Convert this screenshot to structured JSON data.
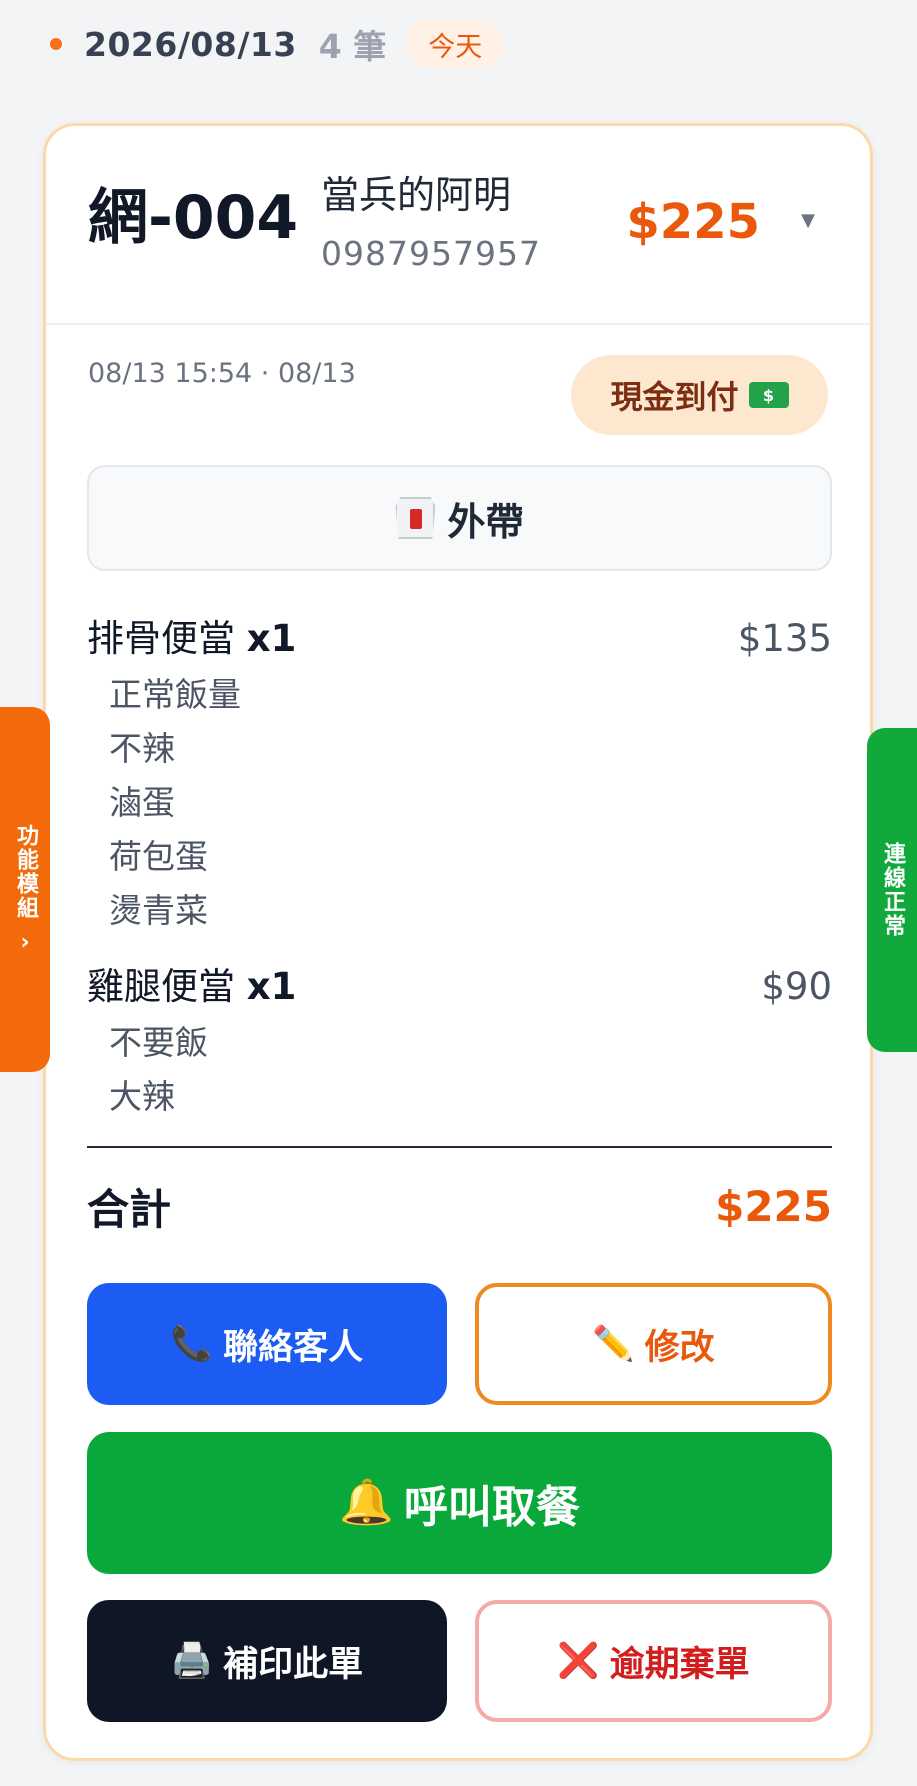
{
  "date_header": {
    "date": "2026/08/13",
    "count": "4 筆",
    "today_badge": "今天"
  },
  "order": {
    "number": "網-004",
    "customer_name": "當兵的阿明",
    "customer_phone": "0987957957",
    "header_total": "$225",
    "time_info": "08/13 15:54 · 08/13",
    "payment_method": "現金到付",
    "service_type": "外帶",
    "items": [
      {
        "name": "排骨便當",
        "qty": "x1",
        "price": "$135",
        "options": [
          "正常飯量",
          "不辣",
          "滷蛋",
          "荷包蛋",
          "燙青菜"
        ]
      },
      {
        "name": "雞腿便當",
        "qty": "x1",
        "price": "$90",
        "options": [
          "不要飯",
          "大辣"
        ]
      }
    ],
    "total_label": "合計",
    "total_value": "$225"
  },
  "actions": {
    "contact": "聯絡客人",
    "edit": "修改",
    "call_pickup": "呼叫取餐",
    "reprint": "補印此單",
    "discard": "逾期棄單"
  },
  "side_tabs": {
    "left": "功能模組",
    "right": "連線正常"
  },
  "colors": {
    "accent": "#ea580c",
    "contact": "#1d5cf2",
    "call": "#0aa83b",
    "print": "#0f1726",
    "discard": "#d31d1d",
    "side_left": "#f36a0b",
    "side_right": "#11a83c"
  }
}
